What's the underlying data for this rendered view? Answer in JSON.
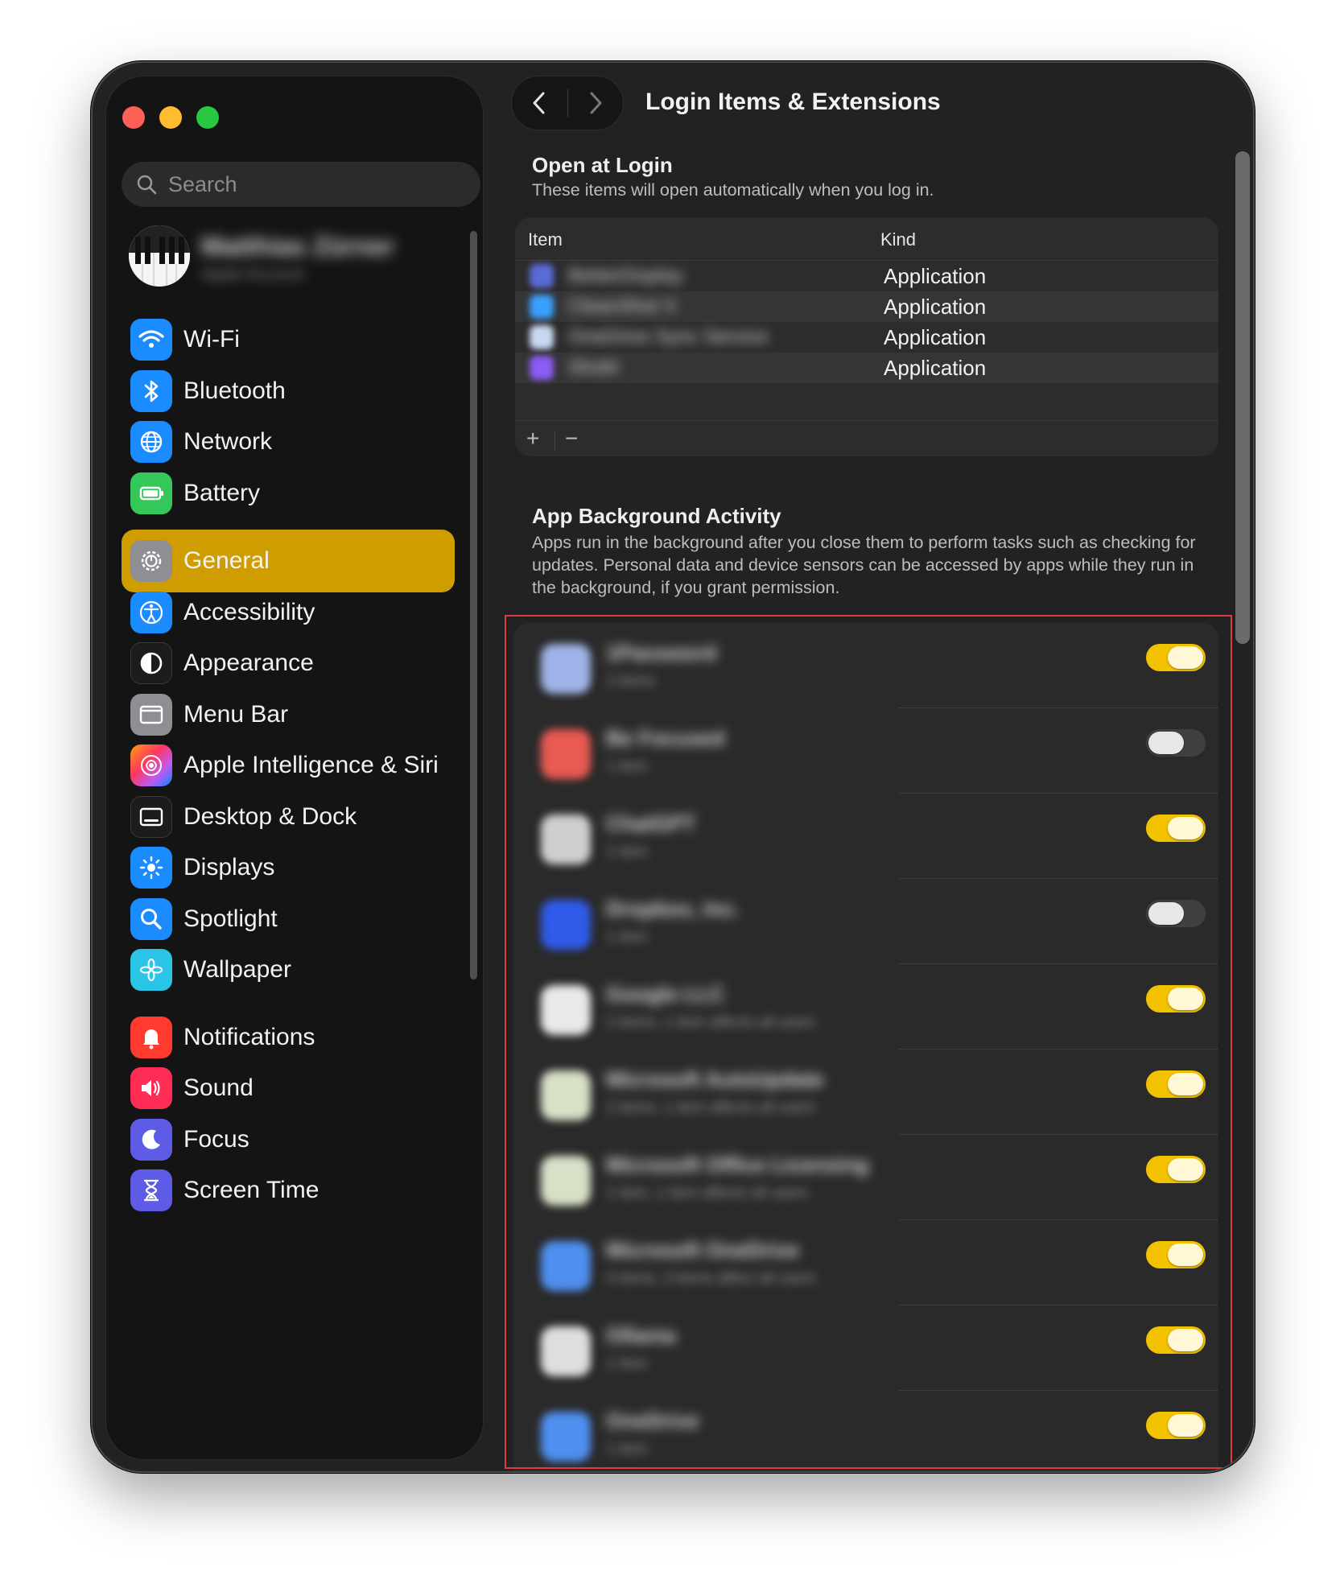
{
  "window": {
    "title": "Login Items & Extensions"
  },
  "sidebar": {
    "search_placeholder": "Search",
    "profile": {
      "name": "Matthias Zürner",
      "subtitle": "Apple Account"
    },
    "items": [
      {
        "label": "Wi-Fi",
        "icon": "wifi-icon",
        "color": "#1a8cff",
        "selected": false
      },
      {
        "label": "Bluetooth",
        "icon": "bluetooth-icon",
        "color": "#1a8cff",
        "selected": false
      },
      {
        "label": "Network",
        "icon": "globe-icon",
        "color": "#1a8cff",
        "selected": false
      },
      {
        "label": "Battery",
        "icon": "battery-icon",
        "color": "#34c759",
        "selected": false
      },
      {
        "label": "General",
        "icon": "gear-icon",
        "color": "#8e8e93",
        "selected": true
      },
      {
        "label": "Accessibility",
        "icon": "accessibility-icon",
        "color": "#1a8cff",
        "selected": false
      },
      {
        "label": "Appearance",
        "icon": "appearance-icon",
        "color": "#1c1c1e",
        "selected": false
      },
      {
        "label": "Menu Bar",
        "icon": "menu-bar-icon",
        "color": "#8e8e93",
        "selected": false
      },
      {
        "label": "Apple Intelligence & Siri",
        "icon": "siri-icon",
        "color": "#ff6a8a",
        "selected": false
      },
      {
        "label": "Desktop & Dock",
        "icon": "dock-icon",
        "color": "#1c1c1e",
        "selected": false
      },
      {
        "label": "Displays",
        "icon": "displays-icon",
        "color": "#1a8cff",
        "selected": false
      },
      {
        "label": "Spotlight",
        "icon": "spotlight-icon",
        "color": "#1a8cff",
        "selected": false
      },
      {
        "label": "Wallpaper",
        "icon": "wallpaper-icon",
        "color": "#2ac4e6",
        "selected": false
      },
      {
        "label": "Notifications",
        "icon": "notifications-icon",
        "color": "#ff3b30",
        "selected": false
      },
      {
        "label": "Sound",
        "icon": "sound-icon",
        "color": "#ff2d55",
        "selected": false
      },
      {
        "label": "Focus",
        "icon": "focus-icon",
        "color": "#5e5ce6",
        "selected": false
      },
      {
        "label": "Screen Time",
        "icon": "hourglass-icon",
        "color": "#5e5ce6",
        "selected": false
      }
    ]
  },
  "open_at_login": {
    "title": "Open at Login",
    "description": "These items will open automatically when you log in.",
    "columns": {
      "item": "Item",
      "kind": "Kind"
    },
    "rows": [
      {
        "name": "BetterDisplay",
        "kind": "Application",
        "icon_color": "#5a6bd8"
      },
      {
        "name": "CleanShot X",
        "kind": "Application",
        "icon_color": "#3aa0ff"
      },
      {
        "name": "OneDrive Sync Service",
        "kind": "Application",
        "icon_color": "#c9d8f2"
      },
      {
        "name": "Shottr",
        "kind": "Application",
        "icon_color": "#8b5cf6"
      }
    ],
    "add_label": "+",
    "remove_label": "−"
  },
  "background_activity": {
    "title": "App Background Activity",
    "description": "Apps run in the background after you close them to perform tasks such as checking for updates. Personal data and device sensors can be accessed by apps while they run in the background, if you grant permission.",
    "items": [
      {
        "name": "1Password",
        "subtitle": "2 items",
        "enabled": true,
        "icon_color": "#9fb4e8"
      },
      {
        "name": "Be Focused",
        "subtitle": "1 item",
        "enabled": false,
        "icon_color": "#e85a52"
      },
      {
        "name": "ChatGPT",
        "subtitle": "1 item",
        "enabled": true,
        "icon_color": "#cfcfcf"
      },
      {
        "name": "Dropbox, Inc.",
        "subtitle": "1 item",
        "enabled": false,
        "icon_color": "#2f5bea"
      },
      {
        "name": "Google LLC",
        "subtitle": "2 items, 1 item affects all users",
        "enabled": true,
        "icon_color": "#e9e9e9"
      },
      {
        "name": "Microsoft AutoUpdate",
        "subtitle": "2 items, 1 item affects all users",
        "enabled": true,
        "icon_color": "#d8e0c8"
      },
      {
        "name": "Microsoft Office Licensing",
        "subtitle": "1 item, 1 item affects all users",
        "enabled": true,
        "icon_color": "#d8e0c8"
      },
      {
        "name": "Microsoft OneDrive",
        "subtitle": "4 items, 3 items affect all users",
        "enabled": true,
        "icon_color": "#4f8ff0"
      },
      {
        "name": "Ollama",
        "subtitle": "1 item",
        "enabled": true,
        "icon_color": "#dedede"
      },
      {
        "name": "OneDrive",
        "subtitle": "1 item",
        "enabled": true,
        "icon_color": "#4f8ff0"
      }
    ]
  }
}
